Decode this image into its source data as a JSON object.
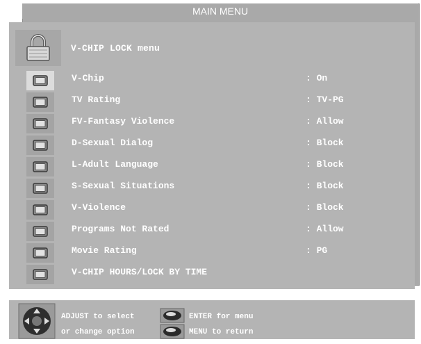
{
  "title": "MAIN MENU",
  "header": "V-CHIP LOCK menu",
  "items": [
    {
      "label": "V-Chip",
      "value": ": On",
      "selected": true
    },
    {
      "label": "TV Rating",
      "value": ": TV-PG"
    },
    {
      "label": "FV-Fantasy Violence",
      "value": ": Allow"
    },
    {
      "label": "D-Sexual Dialog",
      "value": ": Block"
    },
    {
      "label": "L-Adult Language",
      "value": ": Block"
    },
    {
      "label": "S-Sexual Situations",
      "value": ": Block"
    },
    {
      "label": "V-Violence",
      "value": ": Block"
    },
    {
      "label": "Programs Not Rated",
      "value": ": Allow"
    },
    {
      "label": "Movie Rating",
      "value": ": PG"
    },
    {
      "label": "V-CHIP HOURS/LOCK BY TIME",
      "value": ""
    }
  ],
  "footer": {
    "adjust_line1": "ADJUST to select",
    "adjust_line2": "or change option",
    "enter_label": "ENTER for menu",
    "menu_label": "MENU to return"
  },
  "icons": {
    "lock": "lock-icon",
    "item": "tv-icon",
    "pad": "dpad-icon",
    "button": "oval-button-icon"
  },
  "colors": {
    "outer_panel": "#a9a9a9",
    "inner_panel": "#b4b4b4",
    "text": "#ffffff",
    "selected_icon_bg": "#dcdcdc"
  }
}
